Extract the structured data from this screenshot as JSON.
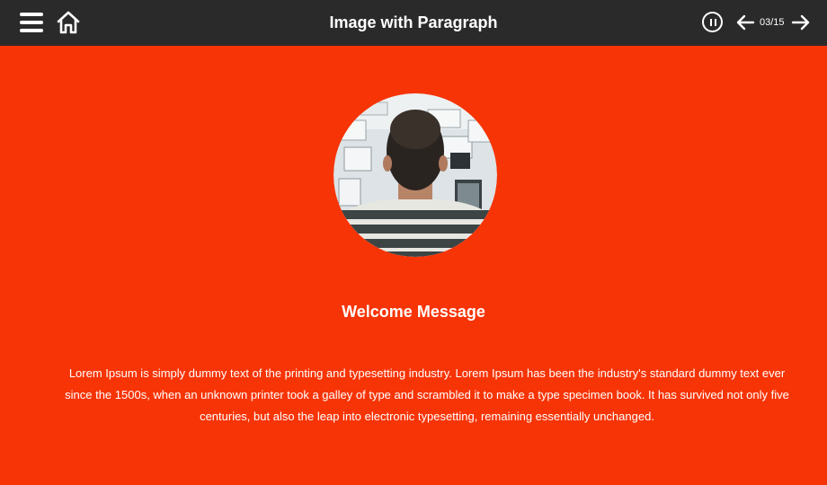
{
  "header": {
    "title": "Image with Paragraph",
    "page_counter": "03/15",
    "background": "#2a2a2a",
    "icons": [
      "hamburger-menu-icon",
      "home-icon",
      "pause-icon",
      "arrow-left-icon",
      "arrow-right-icon"
    ]
  },
  "content": {
    "heading": "Welcome Message",
    "paragraph": "Lorem Ipsum is simply dummy text of the printing and typesetting industry. Lorem Ipsum has been the industry's standard dummy text ever since the 1500s, when an unknown printer took a galley of type and scrambled it to make a type specimen book. It has survived not only five centuries, but also the leap into electronic typesetting, remaining essentially unchanged.",
    "background": "#f73406"
  }
}
